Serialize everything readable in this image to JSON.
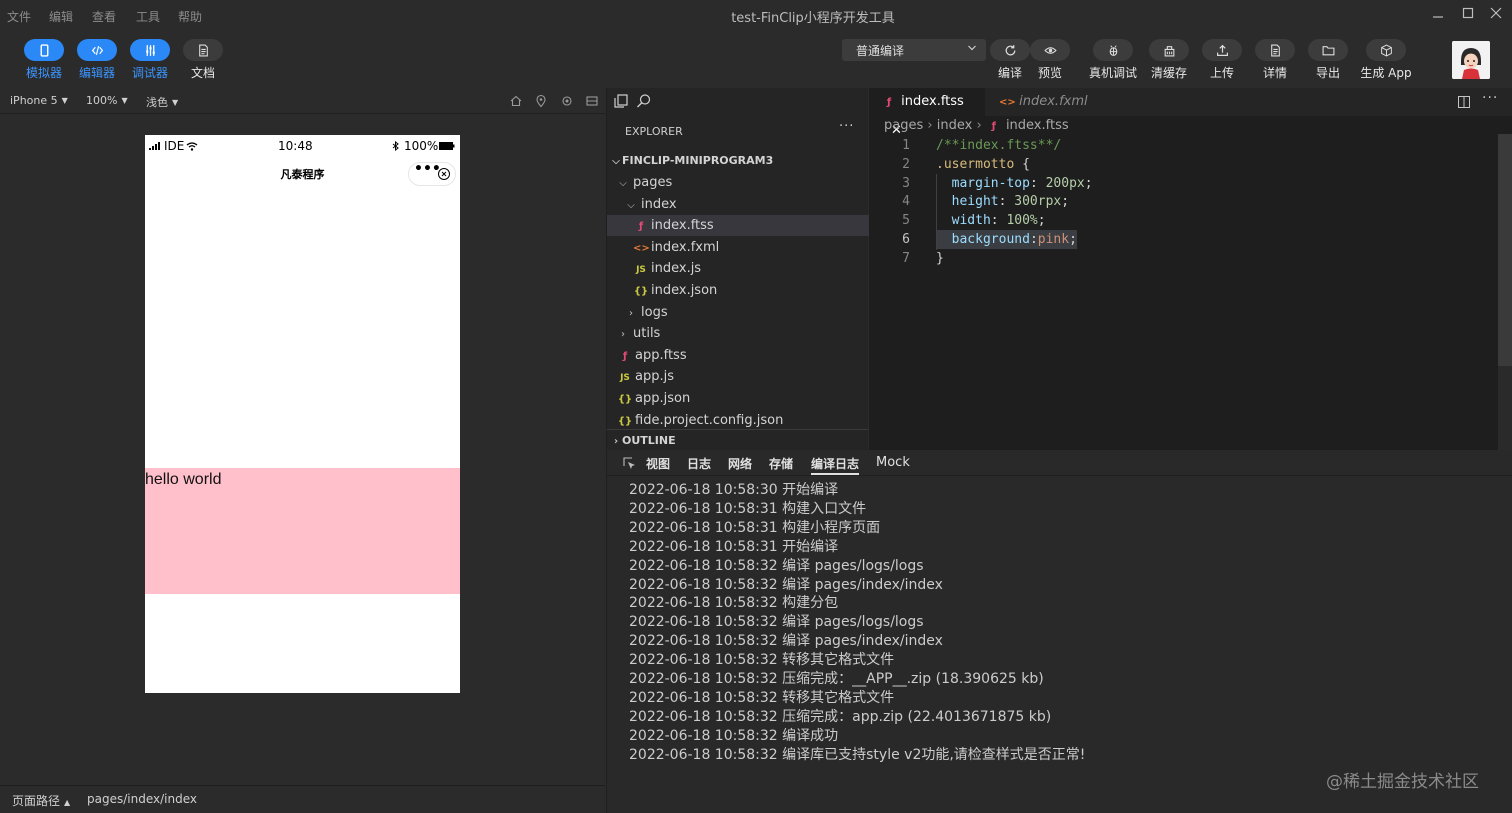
{
  "window": {
    "title": "test-FinClip小程序开发工具",
    "menu": [
      "文件",
      "编辑",
      "查看",
      "工具",
      "帮助"
    ],
    "controls": [
      "minimize-icon",
      "maximize-icon",
      "close-icon"
    ]
  },
  "toolbar": {
    "left": [
      {
        "label": "模拟器",
        "icon": "phone-icon",
        "active": true
      },
      {
        "label": "编辑器",
        "icon": "code-icon",
        "active": true
      },
      {
        "label": "调试器",
        "icon": "sliders-icon",
        "active": true
      },
      {
        "label": "文档",
        "icon": "document-icon",
        "active": false
      }
    ],
    "compile_mode": "普通编译",
    "right": [
      {
        "label": "编译",
        "icon": "refresh-icon"
      },
      {
        "label": "预览",
        "icon": "eye-icon"
      },
      {
        "label": "真机调试",
        "icon": "bug-icon"
      },
      {
        "label": "清缓存",
        "icon": "clear-cache-icon"
      },
      {
        "label": "上传",
        "icon": "upload-icon"
      },
      {
        "label": "详情",
        "icon": "details-icon"
      },
      {
        "label": "导出",
        "icon": "folder-icon"
      },
      {
        "label": "生成 App",
        "icon": "box-icon"
      }
    ]
  },
  "simulator": {
    "device": "iPhone 5",
    "zoom": "100%",
    "theme": "浅色",
    "status_bar": {
      "carrier": "IDE",
      "time": "10:48",
      "battery": "100%"
    },
    "nav_title": "凡泰程序",
    "motto": "hello world",
    "footer_label": "页面路径",
    "footer_path": "pages/index/index"
  },
  "explorer": {
    "header": "EXPLORER",
    "project": "FINCLIP-MINIPROGRAM3",
    "outline": "OUTLINE",
    "tree": [
      {
        "name": "pages",
        "type": "folder-open",
        "level": 1
      },
      {
        "name": "index",
        "type": "folder-open",
        "level": 2
      },
      {
        "name": "index.ftss",
        "type": "ftss",
        "level": 3,
        "selected": true
      },
      {
        "name": "index.fxml",
        "type": "fxml",
        "level": 3
      },
      {
        "name": "index.js",
        "type": "js",
        "level": 3
      },
      {
        "name": "index.json",
        "type": "json",
        "level": 3
      },
      {
        "name": "logs",
        "type": "folder",
        "level": 2
      },
      {
        "name": "utils",
        "type": "folder",
        "level": 1
      },
      {
        "name": "app.ftss",
        "type": "ftss",
        "level": 1
      },
      {
        "name": "app.js",
        "type": "js",
        "level": 1
      },
      {
        "name": "app.json",
        "type": "json",
        "level": 1
      },
      {
        "name": "fide.project.config.json",
        "type": "json",
        "level": 1
      }
    ]
  },
  "editor": {
    "tabs": [
      {
        "name": "index.ftss",
        "active": true
      },
      {
        "name": "index.fxml",
        "active": false
      }
    ],
    "breadcrumb": [
      "pages",
      "index",
      "index.ftss"
    ],
    "lines": [
      {
        "n": "1",
        "tokens": [
          [
            "c-com",
            "/**index.ftss**/"
          ]
        ]
      },
      {
        "n": "2",
        "tokens": [
          [
            "c-sel",
            ".usermotto"
          ],
          [
            "c-punc",
            " {"
          ]
        ]
      },
      {
        "n": "3",
        "tokens": [
          [
            "c-punc",
            "  "
          ],
          [
            "c-prop",
            "margin-top"
          ],
          [
            "c-punc",
            ": "
          ],
          [
            "c-num",
            "200px"
          ],
          [
            "c-punc",
            ";"
          ]
        ]
      },
      {
        "n": "4",
        "tokens": [
          [
            "c-punc",
            "  "
          ],
          [
            "c-prop",
            "height"
          ],
          [
            "c-punc",
            ": "
          ],
          [
            "c-num",
            "300rpx"
          ],
          [
            "c-punc",
            ";"
          ]
        ]
      },
      {
        "n": "5",
        "tokens": [
          [
            "c-punc",
            "  "
          ],
          [
            "c-prop",
            "width"
          ],
          [
            "c-punc",
            ": "
          ],
          [
            "c-num",
            "100%"
          ],
          [
            "c-punc",
            ";"
          ]
        ]
      },
      {
        "n": "6",
        "tokens": [
          [
            "c-punc",
            "  "
          ],
          [
            "c-prop",
            "background"
          ],
          [
            "c-punc",
            ":"
          ],
          [
            "c-pink",
            "pink"
          ],
          [
            "c-punc",
            ";"
          ]
        ],
        "current": true
      },
      {
        "n": "7",
        "tokens": [
          [
            "c-punc",
            "}"
          ]
        ]
      }
    ]
  },
  "console": {
    "tabs": [
      {
        "label": "视图",
        "active": false
      },
      {
        "label": "日志",
        "active": false
      },
      {
        "label": "网络",
        "active": false
      },
      {
        "label": "存储",
        "active": false
      },
      {
        "label": "编译日志",
        "active": true
      },
      {
        "label": "Mock",
        "active": false
      }
    ],
    "logs": [
      "2022-06-18 10:58:30 开始编译",
      "2022-06-18 10:58:31 构建入口文件",
      "2022-06-18 10:58:31 构建小程序页面",
      "2022-06-18 10:58:31 开始编译",
      "2022-06-18 10:58:32 编译 pages/logs/logs",
      "2022-06-18 10:58:32 编译 pages/index/index",
      "2022-06-18 10:58:32 构建分包",
      "2022-06-18 10:58:32 编译 pages/logs/logs",
      "2022-06-18 10:58:32 编译 pages/index/index",
      "2022-06-18 10:58:32 转移其它格式文件",
      "2022-06-18 10:58:32 压缩完成：__APP__.zip (18.390625 kb)",
      "2022-06-18 10:58:32 转移其它格式文件",
      "2022-06-18 10:58:32 压缩完成：app.zip (22.4013671875 kb)",
      "2022-06-18 10:58:32 编译成功",
      "2022-06-18 10:58:32 编译库已支持style v2功能,请检查样式是否正常!"
    ]
  },
  "watermark": "@稀土掘金技术社区",
  "colors": {
    "accent": "#2a88f7",
    "motto_bg": "#ffc0cb",
    "panel": "#2b2b2b",
    "editor_bg": "#1e1e1e"
  }
}
